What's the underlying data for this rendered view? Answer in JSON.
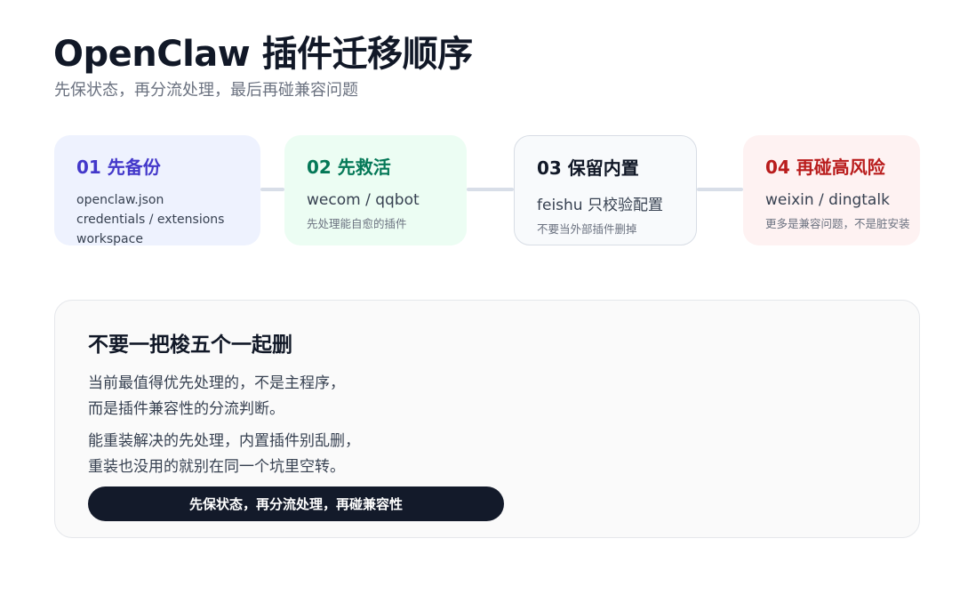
{
  "header": {
    "title": "OpenClaw 插件迁移顺序",
    "subtitle": "先保状态，再分流处理，最后再碰兼容问题"
  },
  "steps": [
    {
      "title": "01 先备份",
      "details": [
        "openclaw.json",
        "credentials / extensions",
        "workspace"
      ]
    },
    {
      "title": "02 先救活",
      "main": "wecom / qqbot",
      "sub": "先处理能自愈的插件"
    },
    {
      "title": "03 保留内置",
      "main": "feishu 只校验配置",
      "sub": "不要当外部插件删掉"
    },
    {
      "title": "04 再碰高风险",
      "main": "weixin / dingtalk",
      "sub": "更多是兼容问题，不是脏安装"
    }
  ],
  "card": {
    "title": "不要一把梭五个一起删",
    "paragraphs": [
      [
        "当前最值得优先处理的，不是主程序，",
        "而是插件兼容性的分流判断。"
      ],
      [
        "能重装解决的先处理，内置插件别乱删，",
        "重装也没用的就别在同一个坑里空转。"
      ]
    ],
    "pill": "先保状态，再分流处理，再碰兼容性"
  },
  "colors": {
    "step1_bg": "#eef2fe",
    "step1_title": "#4338ca",
    "step2_bg": "#ecfdf3",
    "step2_title": "#047857",
    "step3_bg": "#f8fafc",
    "step3_title": "#111827",
    "step4_bg": "#fef2f2",
    "step4_title": "#b91c1c",
    "pill_bg": "#131a2a"
  }
}
